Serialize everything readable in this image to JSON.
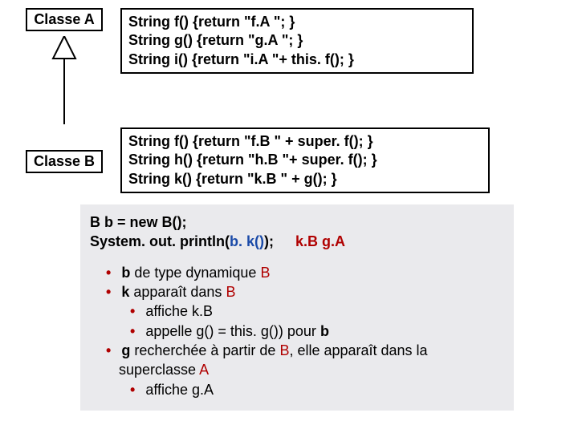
{
  "classA": {
    "label": "Classe A",
    "methods": {
      "f": "String f() {return \"f.A \"; }",
      "g": "String g() {return \"g.A \"; }",
      "i": "String i() {return \"i.A \"+ this. f(); }"
    }
  },
  "classB": {
    "label": "Classe B",
    "methods": {
      "f": "String f() {return \"f.B \" + super. f(); }",
      "h": "String h() {return \"h.B \"+ super. f(); }",
      "k": "String k() {return \"k.B \" + g(); }"
    }
  },
  "eval": {
    "line1": "B b = new B();",
    "line2_pre": "System. out. println(",
    "line2_arg": "b. k()",
    "line2_post": ");",
    "output": "k.B g.A"
  },
  "notes": {
    "n1_b": "b",
    "n1_mid": " de type dynamique ",
    "n1_B": "B",
    "n2_k": "k",
    "n2_mid": " apparaît dans ",
    "n2_B": "B",
    "n3": "affiche k.B",
    "n4_pre": "appelle g() = this. g()) pour ",
    "n4_b": "b",
    "n5_g": "g",
    "n5_mid1": " recherchée à partir de ",
    "n5_B": "B",
    "n5_mid2": ", elle apparaît dans la",
    "n6_pre": "superclasse ",
    "n6_A": "A",
    "n7": "affiche g.A"
  }
}
